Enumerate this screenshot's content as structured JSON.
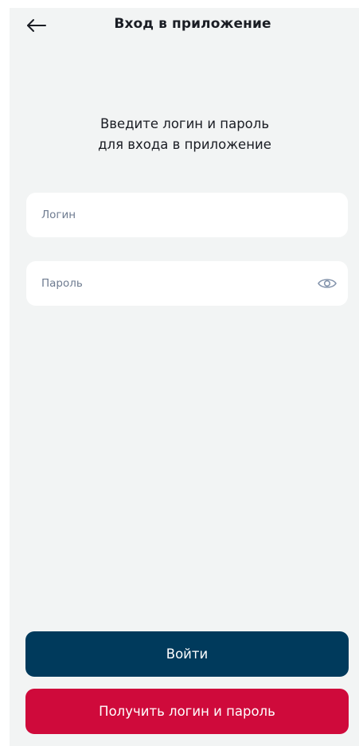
{
  "header": {
    "back_icon": "arrow-left-icon",
    "title": "Вход в приложение"
  },
  "instruction": {
    "line1": "Введите логин и пароль",
    "line2": "для входа в приложение"
  },
  "form": {
    "login": {
      "placeholder": "Логин",
      "value": ""
    },
    "password": {
      "placeholder": "Пароль",
      "value": "",
      "toggle_icon": "eye-icon"
    }
  },
  "actions": {
    "login_label": "Войти",
    "get_credentials_label": "Получить логин и пароль"
  },
  "colors": {
    "background": "#f2f4f4",
    "field_background": "#ffffff",
    "primary_button": "#003a5c",
    "secondary_button": "#cf0a3b",
    "placeholder_text": "#6e7b90",
    "eye_icon": "#8494ac"
  }
}
